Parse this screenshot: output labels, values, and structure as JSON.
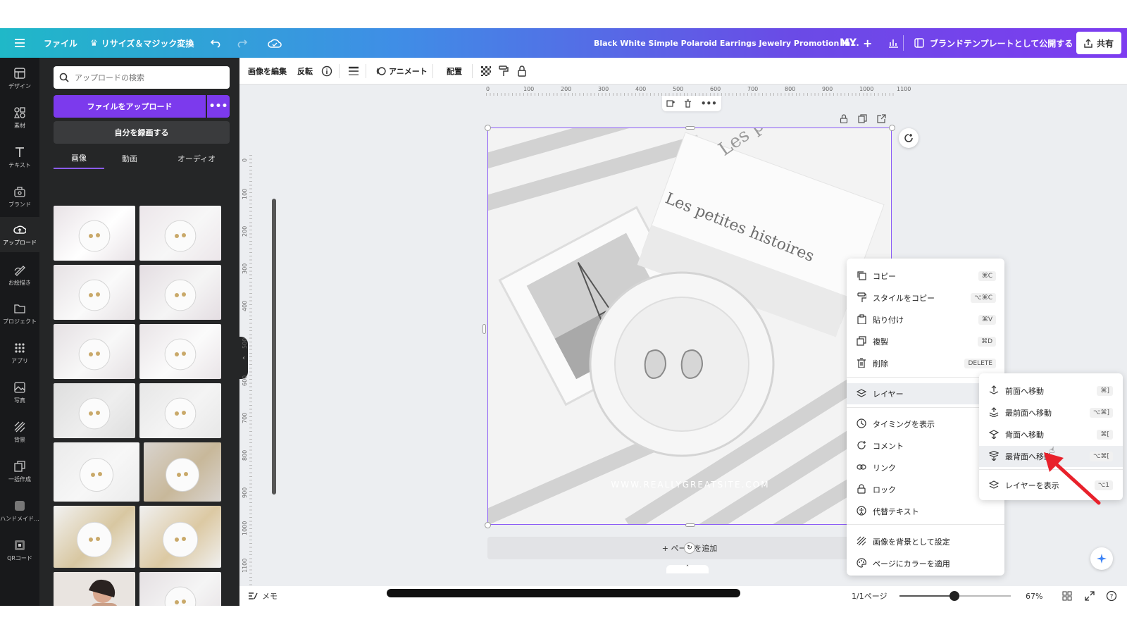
{
  "topbar": {
    "file": "ファイル",
    "resize": "リサイズ＆マジック変換",
    "title": "Black White Simple Polaroid Earrings Jewelry Promotion In...",
    "avatar": "MY",
    "publish": "ブランドテンプレートとして公開する",
    "share": "共有"
  },
  "rail": [
    {
      "label": "デザイン",
      "icon": "design-icon"
    },
    {
      "label": "素材",
      "icon": "elements-icon"
    },
    {
      "label": "テキスト",
      "icon": "text-icon"
    },
    {
      "label": "ブランド",
      "icon": "brand-icon"
    },
    {
      "label": "アップロード",
      "icon": "upload-icon"
    },
    {
      "label": "お絵描き",
      "icon": "draw-icon"
    },
    {
      "label": "プロジェクト",
      "icon": "folder-icon"
    },
    {
      "label": "アプリ",
      "icon": "apps-icon"
    },
    {
      "label": "写真",
      "icon": "photo-icon"
    },
    {
      "label": "背景",
      "icon": "background-icon"
    },
    {
      "label": "一括作成",
      "icon": "bulk-create-icon"
    },
    {
      "label": "ハンドメイド...",
      "icon": "handmade-icon"
    },
    {
      "label": "QRコード",
      "icon": "qr-code-icon"
    }
  ],
  "panel": {
    "search_placeholder": "アップロードの検索",
    "upload_button": "ファイルをアップロード",
    "more": "•••",
    "record_button": "自分を録画する",
    "tabs": [
      "画像",
      "動画",
      "オーディオ"
    ]
  },
  "toolbar": {
    "edit_image": "画像を編集",
    "flip": "反転",
    "animate": "アニメート",
    "position": "配置"
  },
  "ruler_h": [
    "0",
    "100",
    "200",
    "300",
    "400",
    "500",
    "600",
    "700",
    "800",
    "900",
    "1000",
    "1100"
  ],
  "ruler_v": [
    "0",
    "100",
    "200",
    "300",
    "400",
    "500",
    "600",
    "700",
    "800",
    "900",
    "1000",
    "1100"
  ],
  "design": {
    "book_title": "Les petite histoires",
    "book_spine": "Les petites histoires",
    "website": "WWW.REALLYGREATSITE.COM"
  },
  "add_page": "+ ページを追加",
  "context_menu": [
    {
      "label": "コピー",
      "shortcut": "⌘C",
      "icon": "copy-icon"
    },
    {
      "label": "スタイルをコピー",
      "shortcut": "⌥⌘C",
      "icon": "paint-roller-icon"
    },
    {
      "label": "貼り付け",
      "shortcut": "⌘V",
      "icon": "clipboard-icon"
    },
    {
      "label": "複製",
      "shortcut": "⌘D",
      "icon": "duplicate-icon"
    },
    {
      "label": "削除",
      "shortcut": "DELETE",
      "icon": "trash-icon"
    },
    {
      "label": "レイヤー",
      "shortcut": "",
      "icon": "layers-icon"
    },
    {
      "label": "タイミングを表示",
      "shortcut": "",
      "icon": "clock-icon"
    },
    {
      "label": "コメント",
      "shortcut": "⌥",
      "icon": "comment-icon"
    },
    {
      "label": "リンク",
      "shortcut": "",
      "icon": "link-icon"
    },
    {
      "label": "ロック",
      "shortcut": "",
      "icon": "lock-icon"
    },
    {
      "label": "代替テキスト",
      "shortcut": "",
      "icon": "accessibility-icon"
    },
    {
      "label": "画像を背景として設定",
      "shortcut": "",
      "icon": "background-icon"
    },
    {
      "label": "ページにカラーを適用",
      "shortcut": "",
      "icon": "palette-icon"
    }
  ],
  "layer_submenu": [
    {
      "label": "前面へ移動",
      "shortcut": "⌘]",
      "icon": "bring-forward-icon"
    },
    {
      "label": "最前面へ移動",
      "shortcut": "⌥⌘]",
      "icon": "bring-to-front-icon"
    },
    {
      "label": "背面へ移動",
      "shortcut": "⌘[",
      "icon": "send-backward-icon"
    },
    {
      "label": "最背面へ移動",
      "shortcut": "⌥⌘[",
      "icon": "send-to-back-icon"
    },
    {
      "label": "レイヤーを表示",
      "shortcut": "⌥1",
      "icon": "layers-icon"
    }
  ],
  "bottombar": {
    "notes": "メモ",
    "page_info": "1/1ページ",
    "zoom": "67%"
  },
  "colors": {
    "accent": "#7c3aed",
    "arrow": "#e8212b"
  }
}
